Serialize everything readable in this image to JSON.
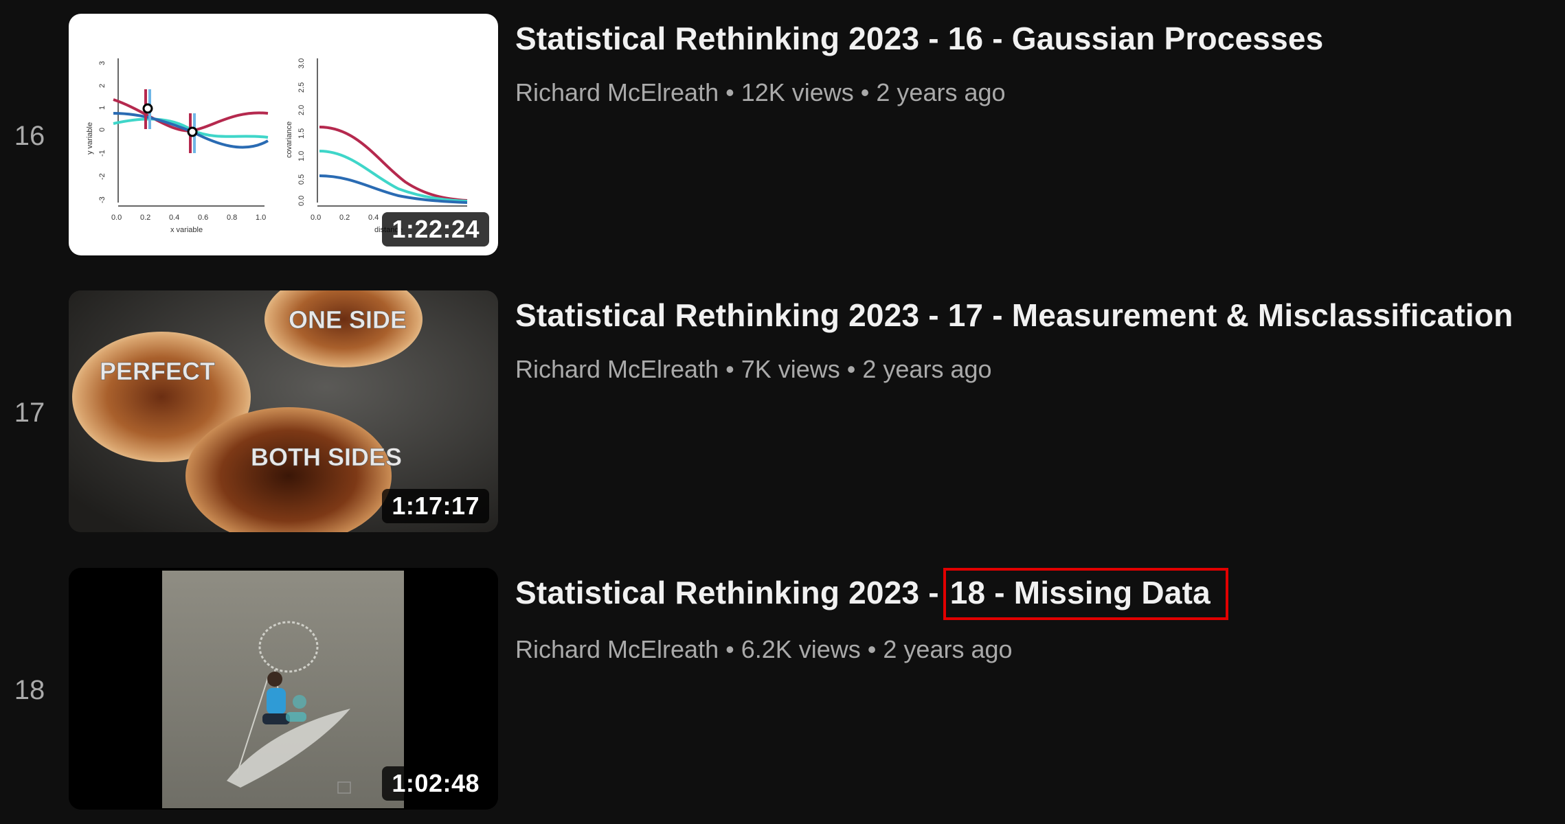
{
  "videos": [
    {
      "index": "16",
      "title": "Statistical Rethinking 2023 - 16 - Gaussian Processes",
      "channel": "Richard McElreath",
      "views": "12K views",
      "age": "2 years ago",
      "duration": "1:22:24",
      "thumbnail_text": {
        "left_ylabel": "y variable",
        "left_xlabel": "x variable",
        "right_ylabel": "covariance",
        "right_xlabel": "distance",
        "left_yticks": [
          "3",
          "2",
          "1",
          "0",
          "-1",
          "-2",
          "-3"
        ],
        "left_xticks": [
          "0.0",
          "0.2",
          "0.4",
          "0.6",
          "0.8",
          "1.0"
        ],
        "right_yticks": [
          "3.0",
          "2.5",
          "2.0",
          "1.5",
          "1.0",
          "0.5",
          "0.0"
        ],
        "right_xticks": [
          "0.0",
          "0.2",
          "0.4"
        ]
      }
    },
    {
      "index": "17",
      "title": "Statistical Rethinking 2023 - 17 - Measurement & Misclassification",
      "channel": "Richard McElreath",
      "views": "7K views",
      "age": "2 years ago",
      "duration": "1:17:17",
      "thumbnail_text": {
        "label_one_side": "ONE SIDE",
        "label_perfect": "PERFECT",
        "label_both_sides": "BOTH SIDES"
      }
    },
    {
      "index": "18",
      "title_prefix": "Statistical Rethinking 2023 -",
      "title_highlight": "18 - Missing Data",
      "channel": "Richard McElreath",
      "views": "6.2K views",
      "age": "2 years ago",
      "duration": "1:02:48"
    }
  ],
  "separator": "•",
  "colors": {
    "background": "#0f0f0f",
    "title": "#f1f1f1",
    "meta": "#aaaaaa",
    "highlight_box": "#e10000",
    "curve_red": "#b5294e",
    "curve_cyan": "#3fd6c9",
    "curve_blue": "#2a6bb3"
  }
}
